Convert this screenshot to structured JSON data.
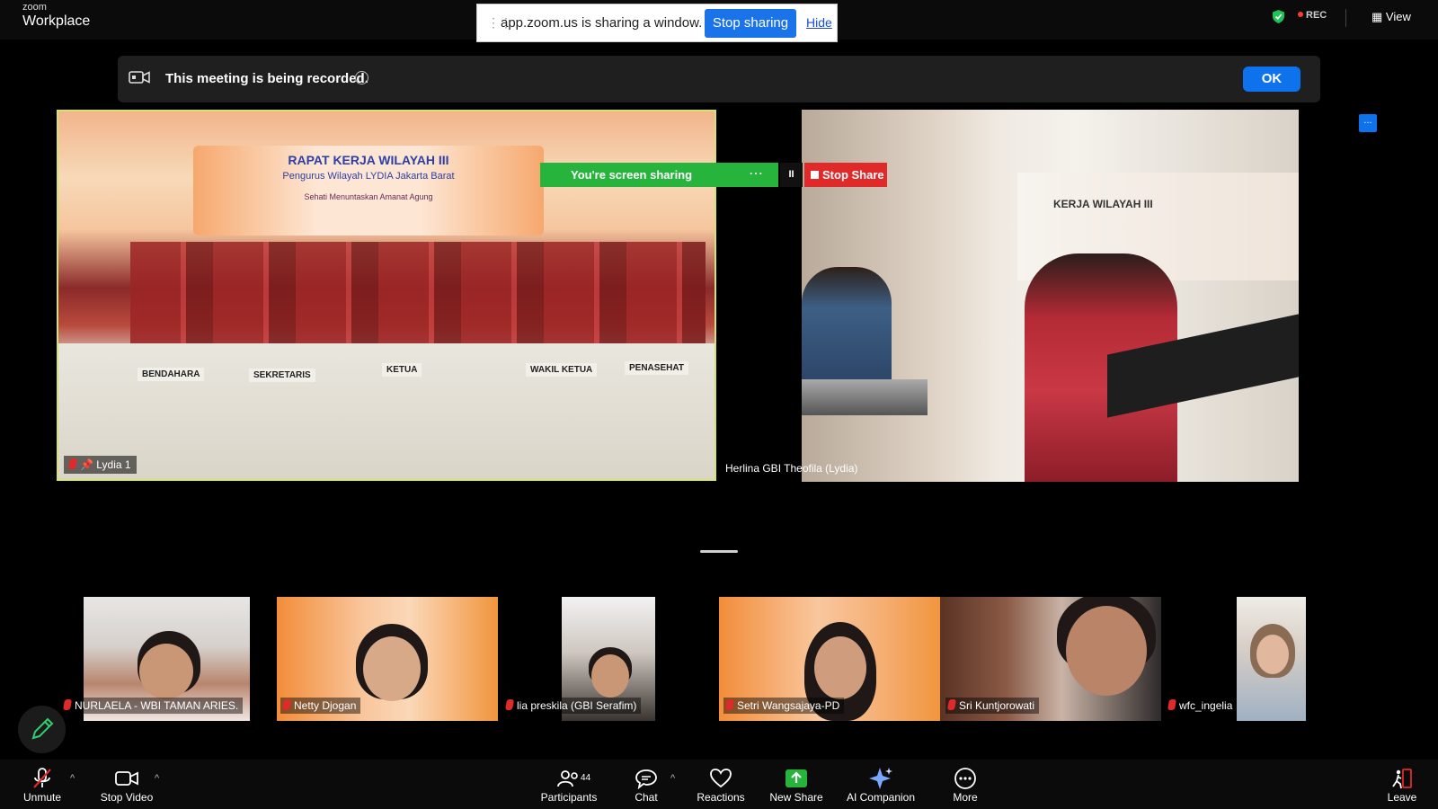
{
  "topbar": {
    "brand_small": "zoom",
    "brand_big": "Workplace",
    "share_message": "app.zoom.us is sharing a window.",
    "stop_sharing": "Stop sharing",
    "hide": "Hide",
    "rec": "REC",
    "view": "View"
  },
  "notice": {
    "text": "This meeting is being recorded.",
    "info": "i",
    "ok": "OK"
  },
  "screen_share": {
    "label": "You're screen sharing",
    "more": "⋯",
    "pause": "II",
    "stop": "Stop Share"
  },
  "side_more": "...",
  "main_tiles": {
    "lydia": {
      "name": "Lydia 1",
      "banner_line1": "RAPAT KERJA WILAYAH III",
      "banner_line2": "Pengurus Wilayah LYDIA Jakarta Barat",
      "banner_line3": "Sehati Menuntaskan Amanat Agung",
      "cards": [
        "BENDAHARA",
        "SEKRETARIS",
        "KETUA",
        "WAKIL KETUA",
        "PENASEHAT"
      ]
    },
    "herlina": {
      "name": "Herlina GBI Theofila (Lydia)",
      "wall_text": "KERJA WILAYAH III"
    }
  },
  "thumbnails": [
    {
      "name": "NURLAELA - WBI TAMAN ARIES."
    },
    {
      "name": "Netty Djogan"
    },
    {
      "name": "lia preskila (GBI Serafim)"
    },
    {
      "name": "Setri Wangsajaya-PD"
    },
    {
      "name": "Sri Kuntjorowati"
    },
    {
      "name": "wfc_ingelia"
    }
  ],
  "toolbar": {
    "unmute": "Unmute",
    "stop_video": "Stop Video",
    "participants": "Participants",
    "participants_count": "44",
    "chat": "Chat",
    "reactions": "Reactions",
    "new_share": "New Share",
    "ai_companion": "AI Companion",
    "more": "More",
    "leave": "Leave"
  },
  "colors": {
    "accent_blue": "#0e72ed",
    "share_green": "#26b43c",
    "stop_red": "#e02a2a",
    "active_speaker_border": "#d7e36a"
  }
}
